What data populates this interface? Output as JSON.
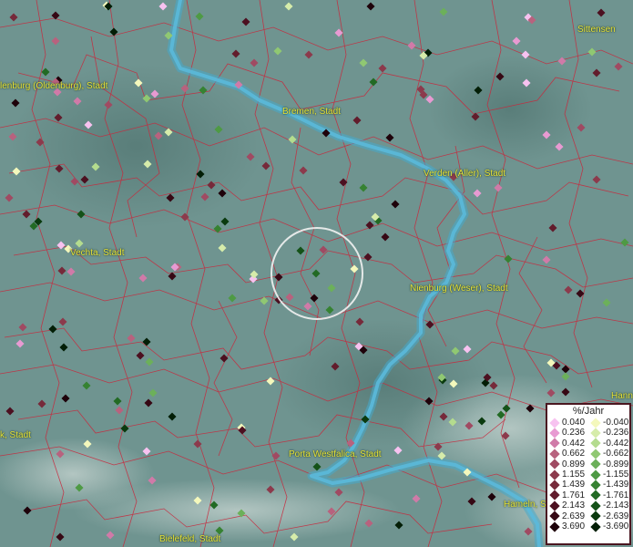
{
  "map": {
    "cities": [
      {
        "name": "Oldenburg (Oldenburg), Stadt",
        "label": "lenburg (Oldenburg), Stadt"
      },
      {
        "name": "Bremen, Stadt",
        "label": "Bremen, Stadt"
      },
      {
        "name": "Sittensen",
        "label": "Sittensen"
      },
      {
        "name": "Verden (Aller), Stadt",
        "label": "Verden (Aller), Stadt"
      },
      {
        "name": "Vechta, Stadt",
        "label": "Vechta, Stadt"
      },
      {
        "name": "Nienburg (Weser), Stadt",
        "label": "Nienburg (Weser), Stadt"
      },
      {
        "name": "Porta Westfalica, Stadt",
        "label": "Porta Westfalica, Stadt"
      },
      {
        "name": "Bielefeld, Stadt",
        "label": "Bielefeld, Stadt"
      },
      {
        "name": "Hameln, Stadt",
        "label": "Hameln, Stadt"
      },
      {
        "name": "Hannover",
        "label": "Hann"
      },
      {
        "name": "Lübbecke, Stadt",
        "label": "k, Stadt"
      }
    ],
    "colors": {
      "background": "#6f9490",
      "river": "#46a9cc",
      "boundaries": "#c8283c",
      "city_label": "#e8e43a",
      "selection_circle": "#f2f2f2"
    }
  },
  "legend": {
    "title": "%/Jahr",
    "positive": [
      {
        "value": "0.040",
        "color": "#f7c2f0"
      },
      {
        "value": "0.236",
        "color": "#e89ad2"
      },
      {
        "value": "0.442",
        "color": "#d07aa8"
      },
      {
        "value": "0.662",
        "color": "#b8627e"
      },
      {
        "value": "0.899",
        "color": "#a04a62"
      },
      {
        "value": "1.155",
        "color": "#8c3a4c"
      },
      {
        "value": "1.439",
        "color": "#762a3a"
      },
      {
        "value": "1.761",
        "color": "#621c2c"
      },
      {
        "value": "2.143",
        "color": "#4c1020"
      },
      {
        "value": "2.639",
        "color": "#360814"
      },
      {
        "value": "3.690",
        "color": "#1e020a"
      }
    ],
    "negative": [
      {
        "value": "-0.040",
        "color": "#f4f8bc"
      },
      {
        "value": "-0.236",
        "color": "#d6ecaa"
      },
      {
        "value": "-0.442",
        "color": "#b4dc8e"
      },
      {
        "value": "-0.662",
        "color": "#90c872"
      },
      {
        "value": "-0.899",
        "color": "#6cb05a"
      },
      {
        "value": "-1.155",
        "color": "#4e9a44"
      },
      {
        "value": "-1.439",
        "color": "#368232"
      },
      {
        "value": "-1.761",
        "color": "#226a24"
      },
      {
        "value": "-2.143",
        "color": "#145218"
      },
      {
        "value": "-2.639",
        "color": "#0a3a0e"
      },
      {
        "value": "-3.690",
        "color": "#031e06"
      }
    ]
  }
}
